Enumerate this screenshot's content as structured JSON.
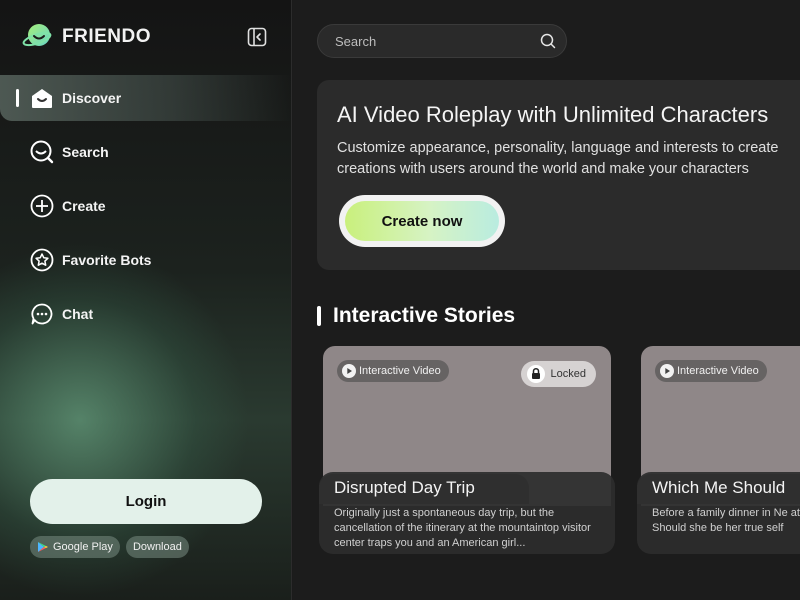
{
  "brand": {
    "name": "FRIENDO"
  },
  "nav": [
    {
      "label": "Discover",
      "icon": "home-smile-icon",
      "active": true
    },
    {
      "label": "Search",
      "icon": "search-icon"
    },
    {
      "label": "Create",
      "icon": "plus-circle-icon"
    },
    {
      "label": "Favorite Bots",
      "icon": "star-badge-icon"
    },
    {
      "label": "Chat",
      "icon": "chat-bubble-icon"
    }
  ],
  "auth": {
    "login_label": "Login"
  },
  "stores": {
    "google_play": "Google Play",
    "download": "Download"
  },
  "search": {
    "placeholder": "Search"
  },
  "hero": {
    "title": "AI Video Roleplay with Unlimited Characters",
    "line1": "Customize appearance, personality, language and interests to create",
    "line2": "creations with users around the world and make your characters",
    "cta": "Create now"
  },
  "section": {
    "title": "Interactive Stories"
  },
  "cards": [
    {
      "tag": "Interactive Video",
      "locked_label": "Locked",
      "title": "Disrupted Day Trip",
      "description": "Originally just a spontaneous day trip, but the cancellation of the itinerary at the mountaintop visitor center traps you and an American girl..."
    },
    {
      "tag": "Interactive Video",
      "title": "Which Me Should",
      "description": "Before a family dinner in Ne at her boss's doorstep and Should she be her true self"
    }
  ],
  "colors": {
    "accent_start": "#c9f07c",
    "accent_end": "#b9ece0",
    "login_bg": "#e3f1ea"
  }
}
